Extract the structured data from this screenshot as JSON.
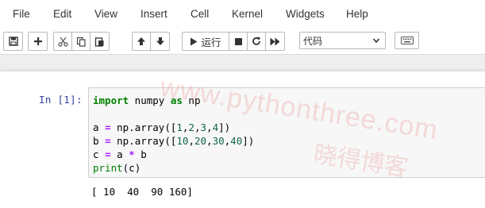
{
  "menubar": {
    "items": [
      "File",
      "Edit",
      "View",
      "Insert",
      "Cell",
      "Kernel",
      "Widgets",
      "Help"
    ]
  },
  "toolbar": {
    "run_label": "运行",
    "cell_type": "代码",
    "icons": [
      "save-icon",
      "plus-icon",
      "cut-icon",
      "copy-icon",
      "paste-icon",
      "arrow-up-icon",
      "arrow-down-icon",
      "play-icon",
      "stop-icon",
      "restart-icon",
      "fast-forward-icon",
      "keyboard-icon"
    ]
  },
  "cell": {
    "prompt": "In  [1]:",
    "code": [
      "import numpy as np",
      "",
      "a = np.array([1,2,3,4])",
      "b = np.array([10,20,30,40])",
      "c = a * b",
      "print(c)"
    ],
    "output": "[ 10  40  90 160]"
  },
  "watermark": {
    "url": "www.pythonthree.com",
    "name": "晓得博客"
  }
}
